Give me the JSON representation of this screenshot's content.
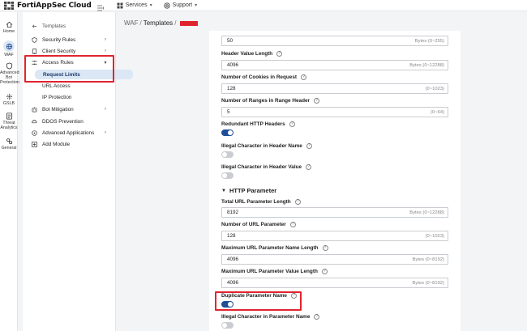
{
  "topbar": {
    "app_title": "FortiAppSec Cloud",
    "menus": [
      {
        "label": "Services",
        "icon": "services-icon"
      },
      {
        "label": "Support",
        "icon": "support-icon"
      }
    ]
  },
  "rail": {
    "items": [
      {
        "label": "Home",
        "icon": "home-icon"
      },
      {
        "label": "WAF",
        "icon": "waf-icon"
      },
      {
        "label": "Advanced Bot Protection",
        "line1": "Advanced",
        "line2": "Bot",
        "line3": "Protection",
        "icon": "bot-icon"
      },
      {
        "label": "GSLB",
        "icon": "gslb-icon"
      },
      {
        "label": "Threat Analytics",
        "line1": "Threat",
        "line2": "Analytics",
        "icon": "threat-icon"
      },
      {
        "label": "General",
        "icon": "general-icon"
      }
    ]
  },
  "sidebar": {
    "back_label": "Templates",
    "items": [
      {
        "label": "Security Rules",
        "icon": "shield-icon"
      },
      {
        "label": "Client Security",
        "icon": "client-icon"
      },
      {
        "label": "Access Rules",
        "icon": "access-icon"
      },
      {
        "label": "Request Limits"
      },
      {
        "label": "URL Access"
      },
      {
        "label": "IP Protection"
      },
      {
        "label": "Bot Mitigation",
        "icon": "bot-mitigation-icon"
      },
      {
        "label": "DDOS Prevention",
        "icon": "ddos-icon"
      },
      {
        "label": "Advanced Applications",
        "icon": "apps-icon"
      },
      {
        "label": "Add Module",
        "icon": "add-icon"
      }
    ]
  },
  "breadcrumb": {
    "root": "WAF",
    "current": "Templates"
  },
  "form": {
    "top_value": "50",
    "top_hint": "Bytes (0~255)",
    "fields": [
      {
        "label": "Header Value Length",
        "value": "4096",
        "hint": "Bytes (0~12288)"
      },
      {
        "label": "Number of Cookies in Request",
        "value": "128",
        "hint": "(0~1023)"
      },
      {
        "label": "Number of Ranges in Range Header",
        "value": "5",
        "hint": "(0~64)"
      }
    ],
    "toggles_a": [
      {
        "label": "Redundant HTTP Headers",
        "on": true
      },
      {
        "label": "Illegal Character in Header Name",
        "on": false
      },
      {
        "label": "Illegal Character in Header Value",
        "on": false
      }
    ],
    "section_title": "HTTP Parameter",
    "param_fields": [
      {
        "label": "Total URL Parameter Length",
        "value": "8192",
        "hint": "Bytes (0~12288)"
      },
      {
        "label": "Number of URL Parameter",
        "value": "128",
        "hint": "(0~1023)"
      },
      {
        "label": "Maximum URL Parameter Name Length",
        "value": "4096",
        "hint": "Bytes (0~8192)"
      },
      {
        "label": "Maximum URL Parameter Value Length",
        "value": "4096",
        "hint": "Bytes (0~8192)"
      }
    ],
    "toggles_b": [
      {
        "label": "Duplicate Parameter Name",
        "on": true
      },
      {
        "label": "Illegal Character in Parameter Name",
        "on": false
      }
    ]
  },
  "colors": {
    "accent": "#1e4e96",
    "highlight": "#e0242f",
    "active_bg": "#dbe7f5"
  }
}
